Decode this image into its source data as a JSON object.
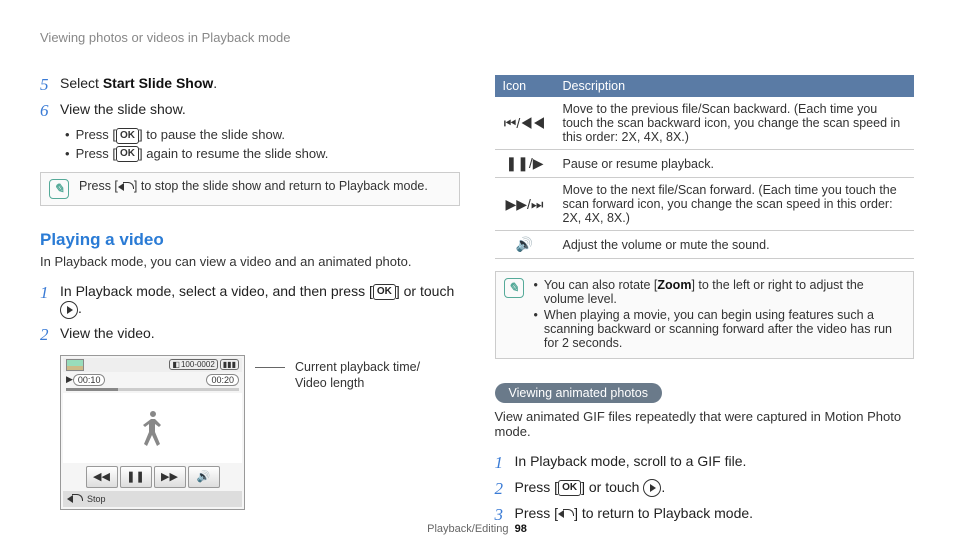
{
  "header": "Viewing photos or videos in Playback mode",
  "left": {
    "step5_num": "5",
    "step5_pre": "Select ",
    "step5_bold": "Start Slide Show",
    "step5_post": ".",
    "step6_num": "6",
    "step6_text": "View the slide show.",
    "step6_b1_pre": "Press [",
    "step6_b1_icon": "OK",
    "step6_b1_post": "] to pause the slide show.",
    "step6_b2_pre": "Press [",
    "step6_b2_icon": "OK",
    "step6_b2_post": "] again to resume the slide show.",
    "note1_pre": "Press [",
    "note1_post": "] to stop the slide show and return to Playback mode.",
    "section_title": "Playing a video",
    "section_desc": "In Playback mode, you can view a video and an animated photo.",
    "pv_step1_num": "1",
    "pv_step1_pre": "In Playback mode, select a video, and then press [",
    "pv_step1_icon": "OK",
    "pv_step1_mid": "] or touch ",
    "pv_step1_post": ".",
    "pv_step2_num": "2",
    "pv_step2_text": "View the video.",
    "video": {
      "res": "100-0002",
      "time_cur": "00:10",
      "time_len": "00:20",
      "stop": "Stop"
    },
    "pointer_label_l1": "Current playback time/",
    "pointer_label_l2": "Video length"
  },
  "right": {
    "th_icon": "Icon",
    "th_desc": "Description",
    "rows": [
      {
        "icon": "⏮/◀◀",
        "desc": "Move to the previous file/Scan backward. (Each time you touch the scan backward icon, you change the scan speed in this order: 2X, 4X, 8X.)"
      },
      {
        "icon": "❚❚/▶",
        "desc": "Pause or resume playback."
      },
      {
        "icon": "▶▶/⏭",
        "desc": "Move to the next file/Scan forward. (Each time you touch the scan forward icon, you change the scan speed in this order: 2X, 4X, 8X.)"
      },
      {
        "icon": "🔊",
        "desc": "Adjust the volume or mute the sound."
      }
    ],
    "note2_l1_pre": "You can also rotate [",
    "note2_l1_bold": "Zoom",
    "note2_l1_post": "] to the left or right to adjust the volume level.",
    "note2_l2": "When playing a movie, you can begin using features such a scanning backward or scanning forward after the video has run for 2 seconds.",
    "pill": "Viewing animated photos",
    "pill_desc": "View animated GIF files repeatedly that were captured in Motion Photo mode.",
    "ap_step1_num": "1",
    "ap_step1_text": "In Playback mode, scroll to a GIF file.",
    "ap_step2_num": "2",
    "ap_step2_pre": "Press [",
    "ap_step2_icon": "OK",
    "ap_step2_mid": "] or touch ",
    "ap_step2_post": ".",
    "ap_step3_num": "3",
    "ap_step3_pre": "Press [",
    "ap_step3_post": "] to return to Playback mode."
  },
  "footer_section": "Playback/Editing",
  "footer_page": "98"
}
